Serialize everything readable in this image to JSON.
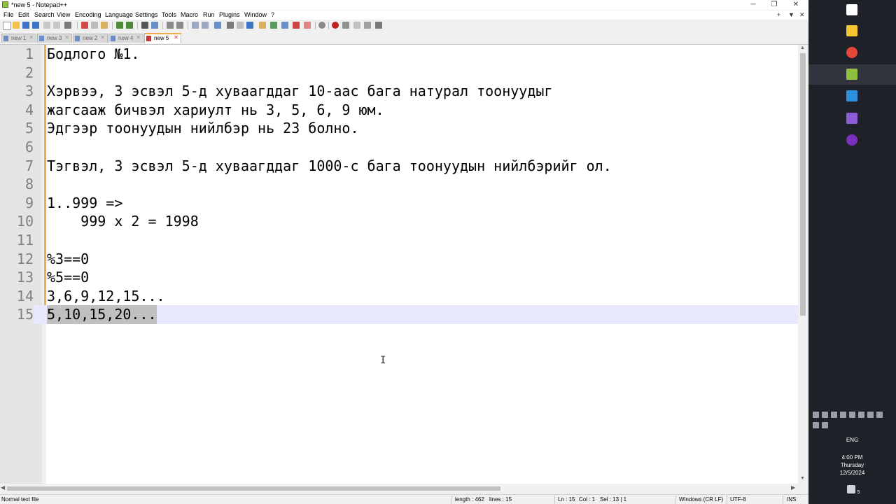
{
  "window": {
    "title": "*new 5 - Notepad++",
    "minimize_glyph": "─",
    "restore_glyph": "❐",
    "close_glyph": "✕"
  },
  "menu": {
    "items": [
      "File",
      "Edit",
      "Search",
      "View",
      "Encoding",
      "Language",
      "Settings",
      "Tools",
      "Macro",
      "Run",
      "Plugins",
      "Window",
      "?"
    ],
    "right_plus": "+",
    "right_down": "▼",
    "right_close": "✕"
  },
  "tabs": [
    {
      "label": "new 1",
      "active": false
    },
    {
      "label": "new 3",
      "active": false
    },
    {
      "label": "new 2",
      "active": false
    },
    {
      "label": "new 4",
      "active": false
    },
    {
      "label": "new 5",
      "active": true
    }
  ],
  "tab_close": "✕",
  "editor": {
    "lines": [
      {
        "num": "1",
        "text": "Бодлого №1."
      },
      {
        "num": "2",
        "text": ""
      },
      {
        "num": "3",
        "text": "Хэрвээ, 3 эсвэл 5-д хуваагддаг 10-аас бага натурал тоонуудыг"
      },
      {
        "num": "4",
        "text": "жагсааж бичвэл хариулт нь 3, 5, 6, 9 юм."
      },
      {
        "num": "5",
        "text": "Эдгээр тоонуудын нийлбэр нь 23 болно."
      },
      {
        "num": "6",
        "text": ""
      },
      {
        "num": "7",
        "text": "Тэгвэл, 3 эсвэл 5-д хуваагддаг 1000-с бага тоонуудын нийлбэрийг ол."
      },
      {
        "num": "8",
        "text": ""
      },
      {
        "num": "9",
        "text": "1..999 =>"
      },
      {
        "num": "10",
        "text": "    999 x 2 = 1998"
      },
      {
        "num": "11",
        "text": ""
      },
      {
        "num": "12",
        "text": "%3==0"
      },
      {
        "num": "13",
        "text": "%5==0"
      },
      {
        "num": "14",
        "text": "3,6,9,12,15..."
      },
      {
        "num": "15",
        "text": "5,10,15,20..."
      }
    ],
    "current_line": 15,
    "mouse_cursor": "I"
  },
  "scroll": {
    "up": "▲",
    "down": "▼",
    "left": "◀",
    "right": "▶"
  },
  "status": {
    "type": "Normal text file",
    "length": "length : 462",
    "lines": "lines : 15",
    "ln": "Ln : 15",
    "col": "Col : 1",
    "sel": "Sel : 13 | 1",
    "eol": "Windows (CR LF)",
    "encoding": "UTF-8",
    "mode": "INS"
  },
  "taskbar": {
    "icons": [
      {
        "name": "windows-start-icon",
        "color": "#ffffff"
      },
      {
        "name": "file-explorer-icon",
        "color": "#f4c431"
      },
      {
        "name": "chrome-icon",
        "color": "#e4473a"
      },
      {
        "name": "notepadpp-icon",
        "color": "#8fbf3f"
      },
      {
        "name": "vscode-icon",
        "color": "#2c8fe0"
      },
      {
        "name": "visual-studio-icon",
        "color": "#8b5cd6"
      },
      {
        "name": "app-purple-icon",
        "color": "#7b2fbf"
      }
    ],
    "language": "ENG",
    "time": "4:00 PM",
    "day": "Thursday",
    "date": "12/5/2024",
    "notification_count": "5"
  }
}
